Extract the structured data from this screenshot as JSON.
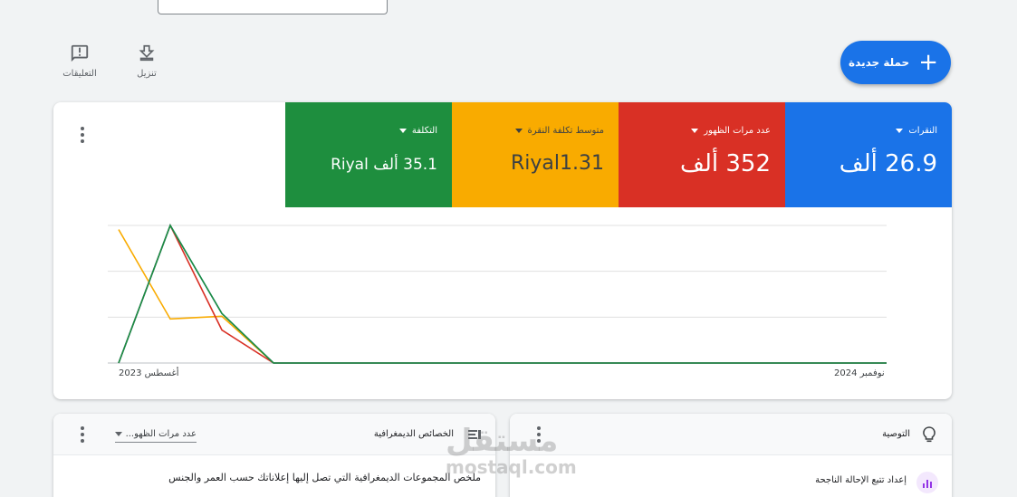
{
  "toolbar": {
    "feedback_label": "التعليقات",
    "download_label": "تنزيل",
    "new_campaign_label": "حملة جديدة"
  },
  "metrics": [
    {
      "label": "النقرات",
      "value": "26.9 ألف",
      "color": "#1a73e8"
    },
    {
      "label": "عدد مرات الظهور",
      "value": "352 ألف",
      "color": "#d93025"
    },
    {
      "label": "متوسط تكلفة النقرة",
      "value": "Riyal1.31",
      "color": "#f9ab00"
    },
    {
      "label": "التكلفة",
      "value": "35.1 ألف Riyal",
      "color": "#1e8e3e"
    }
  ],
  "chart_data": {
    "type": "line",
    "x_start_label": "أغسطس 2023",
    "x_end_label": "نوفمبر 2024",
    "gridlines": 3,
    "series": [
      {
        "color": "#f9ab00",
        "values": [
          0.97,
          0.32,
          0.34,
          0,
          0,
          0,
          0,
          0,
          0,
          0,
          0,
          0,
          0,
          0,
          0,
          0
        ]
      },
      {
        "color": "#d93025",
        "values": [
          0,
          1.0,
          0.24,
          0,
          0,
          0,
          0,
          0,
          0,
          0,
          0,
          0,
          0,
          0,
          0,
          0
        ]
      },
      {
        "color": "#1a73e8",
        "values": [
          0,
          1.0,
          0.36,
          0,
          0,
          0,
          0,
          0,
          0,
          0,
          0,
          0,
          0,
          0,
          0,
          0
        ]
      },
      {
        "color": "#1e8e3e",
        "values": [
          0,
          1.0,
          0.36,
          0,
          0,
          0,
          0,
          0,
          0,
          0,
          0,
          0,
          0,
          0,
          0,
          0
        ]
      }
    ]
  },
  "demographics": {
    "title": "الخصائص الديمغرافية",
    "select_value": "عدد مرات الظهو...",
    "description": "ملخص المجموعات الديمغرافية التي تصل إليها إعلاناتك حسب العمر والجنس"
  },
  "recommendations": {
    "title": "التوصية",
    "item_label": "إعداد تتبع الإحالة الناجحة"
  },
  "watermark": {
    "arabic": "مستقل",
    "latin": "mostaql.com"
  }
}
